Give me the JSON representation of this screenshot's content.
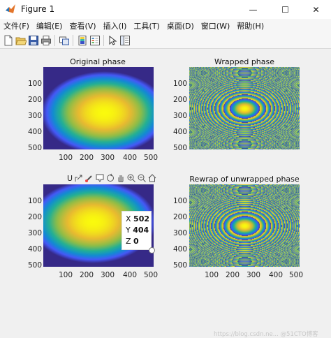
{
  "window": {
    "title": "Figure 1",
    "controls": {
      "minimize": "—",
      "maximize": "☐",
      "close": "✕"
    }
  },
  "menu": [
    {
      "label": "文件(F)"
    },
    {
      "label": "编辑(E)"
    },
    {
      "label": "查看(V)"
    },
    {
      "label": "插入(I)"
    },
    {
      "label": "工具(T)"
    },
    {
      "label": "桌面(D)"
    },
    {
      "label": "窗口(W)"
    },
    {
      "label": "帮助(H)"
    }
  ],
  "toolbar": [
    {
      "name": "new-figure-icon"
    },
    {
      "name": "open-file-icon"
    },
    {
      "name": "save-icon"
    },
    {
      "name": "print-icon"
    },
    {
      "name": "link-plot-icon"
    },
    {
      "name": "insert-colorbar-icon"
    },
    {
      "name": "insert-legend-icon"
    },
    {
      "name": "edit-plot-arrow-icon"
    },
    {
      "name": "property-inspector-icon"
    }
  ],
  "axes": [
    {
      "id": "original",
      "title": "Original phase",
      "pattern": "smooth",
      "colormap": "parula",
      "center": [
        0.55,
        0.55
      ],
      "yticks": [
        "100",
        "200",
        "300",
        "400",
        "500"
      ],
      "xticks": []
    },
    {
      "id": "wrapped",
      "title": "Wrapped phase",
      "pattern": "rings",
      "colormap": "parula",
      "center": [
        0.5,
        0.5
      ],
      "yticks": [
        "100",
        "200",
        "300",
        "400",
        "500"
      ],
      "xticks": [
        "100",
        "200",
        "300",
        "400",
        "500"
      ]
    },
    {
      "id": "unwrapped",
      "title": "",
      "pattern": "smooth",
      "colormap": "parula",
      "center": [
        0.45,
        0.45
      ],
      "yticks": [
        "100",
        "200",
        "300",
        "400",
        "500"
      ],
      "xticks": [
        "100",
        "200",
        "300",
        "400",
        "500"
      ]
    },
    {
      "id": "rewrap",
      "title": "Rewrap of unwrapped phase",
      "pattern": "rings",
      "colormap": "parula",
      "center": [
        0.5,
        0.5
      ],
      "yticks": [
        "100",
        "200",
        "300",
        "400",
        "500"
      ],
      "xticks": [
        "100",
        "200",
        "300",
        "400",
        "500"
      ]
    }
  ],
  "axes_toolbar": {
    "label": "U",
    "icons": [
      "export-icon",
      "brush-icon",
      "datatip-icon",
      "rotate-icon",
      "pan-icon",
      "zoom-in-icon",
      "zoom-out-icon",
      "home-icon"
    ]
  },
  "datatip": {
    "x_label": "X",
    "x_value": "502",
    "y_label": "Y",
    "y_value": "404",
    "z_label": "Z",
    "z_value": "0"
  },
  "watermark": "https://blog.csdn.ne... @51CTO博客"
}
